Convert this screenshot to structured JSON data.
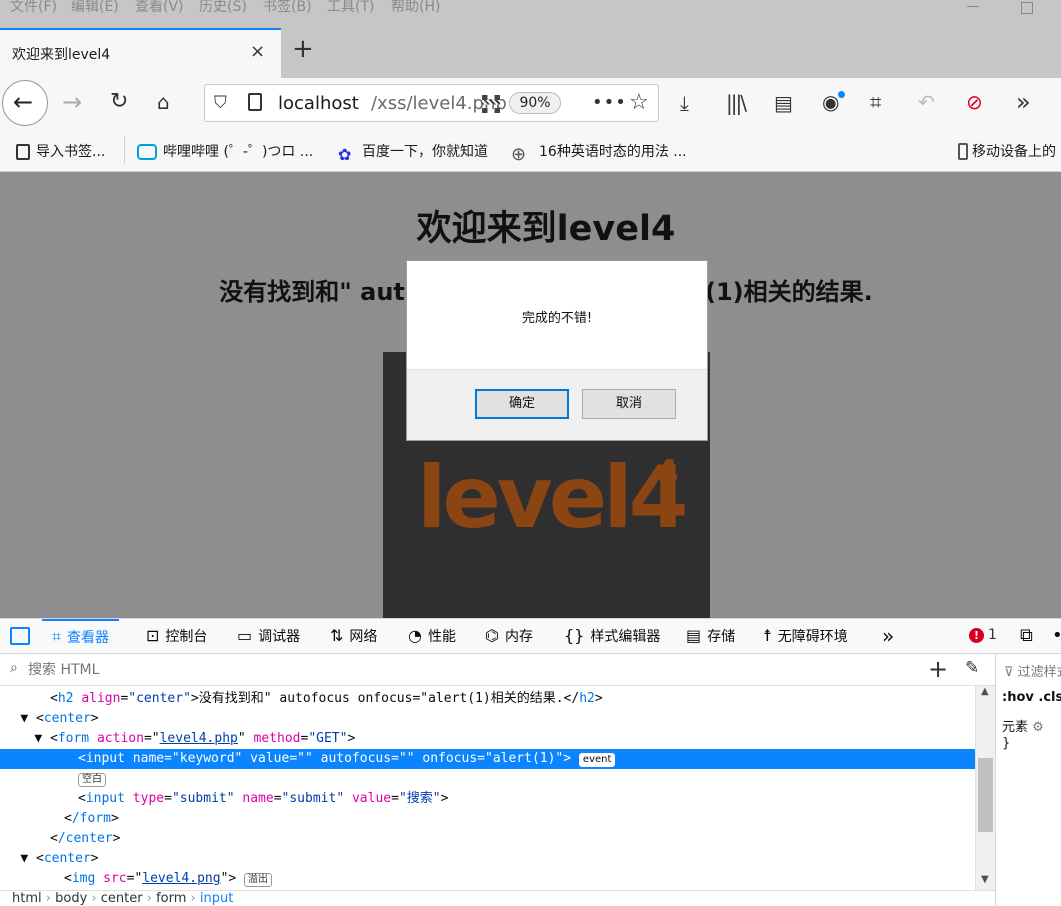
{
  "menubar": [
    "文件(F)",
    "编辑(E)",
    "查看(V)",
    "历史(S)",
    "书签(B)",
    "工具(T)",
    "帮助(H)"
  ],
  "tab": {
    "title": "欢迎来到level4",
    "close": "×"
  },
  "newtab": "+",
  "urlbar": {
    "host": "localhost",
    "path": "/xss/level4.php",
    "zoom": "90%",
    "more": "•••"
  },
  "bookmarks": [
    "导入书签...",
    "哔哩哔哩 (゜-゜)つロ ...",
    "百度一下，你就知道",
    "16种英语时态的用法 ...",
    "移动设备上的"
  ],
  "page": {
    "h1": "欢迎来到level4",
    "h2": "没有找到和\" autofocus onfocus=\"alert(1)相关的结果.",
    "image_text": "level4"
  },
  "dialog": {
    "message": "完成的不错!",
    "ok": "确定",
    "cancel": "取消"
  },
  "devtools": {
    "tabs": [
      "查看器",
      "控制台",
      "调试器",
      "网络",
      "性能",
      "内存",
      "样式编辑器",
      "存储",
      "无障碍环境"
    ],
    "error_count": "1",
    "search_placeholder": "搜索 HTML",
    "breadcrumbs": [
      "html",
      "body",
      "center",
      "form",
      "input"
    ],
    "sidepanel": {
      "filter": "过滤样式",
      "hov": ":hov  .cls",
      "element": "元素",
      "brace": "}"
    },
    "markup": {
      "l1": {
        "open": "<",
        "tag": "h2",
        "attr": "align",
        "val": "\"center\"",
        "text": ">没有找到和\" autofocus onfocus=\"alert(1)相关的结果.</",
        "close": ">"
      },
      "l2": {
        "tag": "center"
      },
      "l3": {
        "tag": "form",
        "a1": "action",
        "v1": "level4.php",
        "a2": "method",
        "v2": "\"GET\""
      },
      "l4": {
        "text": "<input name=\"keyword\" value=\"\" autofocus=\"\" onfocus=\"alert(1)\">",
        "badge": "event"
      },
      "l5": {
        "badge": "空白"
      },
      "l6": {
        "tag": "input",
        "a1": "type",
        "v1": "\"submit\"",
        "a2": "name",
        "v2": "\"submit\"",
        "a3": "value",
        "v3": "\"搜索\""
      },
      "l7": {
        "tag": "/form"
      },
      "l8": {
        "tag": "/center"
      },
      "l9": {
        "tag": "center"
      },
      "l10": {
        "tag": "img",
        "a1": "src",
        "v1": "level4.png",
        "badge": "溢出"
      }
    }
  },
  "colors": {
    "accent": "#0a84ff",
    "content_bg": "#8e8e8e",
    "logo": "#8b4513"
  },
  "icons": [
    "back-arrow-icon",
    "forward-arrow-icon",
    "reload-icon",
    "home-icon",
    "shield-icon",
    "page-icon",
    "qr-code-icon",
    "page-actions-icon",
    "bookmark-star-icon",
    "download-icon",
    "library-icon",
    "sidebar-icon",
    "account-icon",
    "screenshot-icon",
    "undo-icon",
    "no-script-icon",
    "overflow-icon"
  ]
}
